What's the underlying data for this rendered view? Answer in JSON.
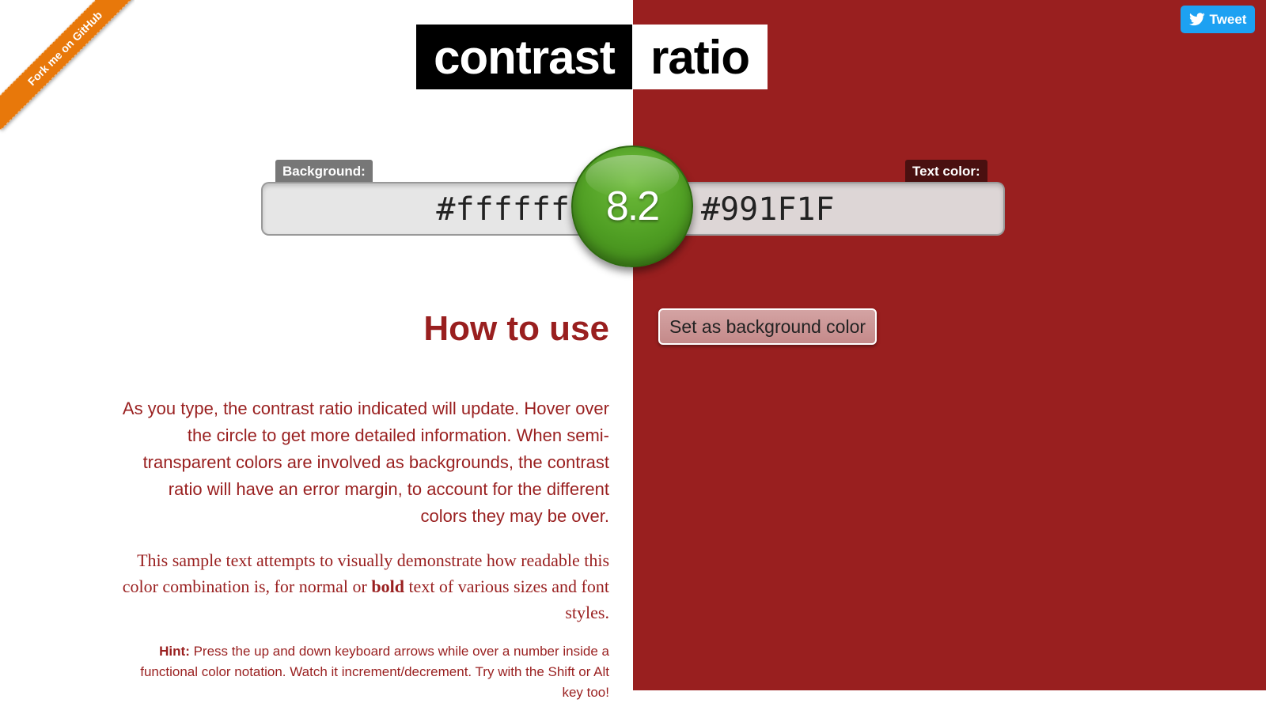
{
  "ribbon": {
    "label": "Fork me on GitHub"
  },
  "tweet": {
    "label": "Tweet"
  },
  "logo": {
    "part1": "contrast",
    "part2": "ratio"
  },
  "background": {
    "label": "Background:",
    "value": "#ffffff"
  },
  "text_color": {
    "label": "Text color:",
    "value": "#991F1F"
  },
  "ratio": {
    "value": "8.2"
  },
  "swap_button": {
    "label": "Set as background color"
  },
  "howto": {
    "title": "How to use",
    "para1": "As you type, the contrast ratio indicated will update. Hover over the circle to get more detailed information. When semi-transparent colors are involved as backgrounds, the contrast ratio will have an error margin, to account for the different colors they may be over.",
    "sample_pre": "This sample text attempts to visually demonstrate how readable this color combination is, for normal or ",
    "sample_bold": "bold",
    "sample_post": " text of various sizes and font styles.",
    "hint_label": "Hint:",
    "hint_text": " Press the up and down keyboard arrows while over a number inside a functional color notation. Watch it increment/decrement. Try with the Shift or Alt key too!"
  },
  "colors": {
    "background": "#ffffff",
    "text": "#991F1F",
    "ratio_circle": "#4f9e23",
    "ribbon": "#e8780a",
    "tweet": "#1da1f2"
  },
  "icons": {
    "tweet": "twitter-bird-icon"
  }
}
